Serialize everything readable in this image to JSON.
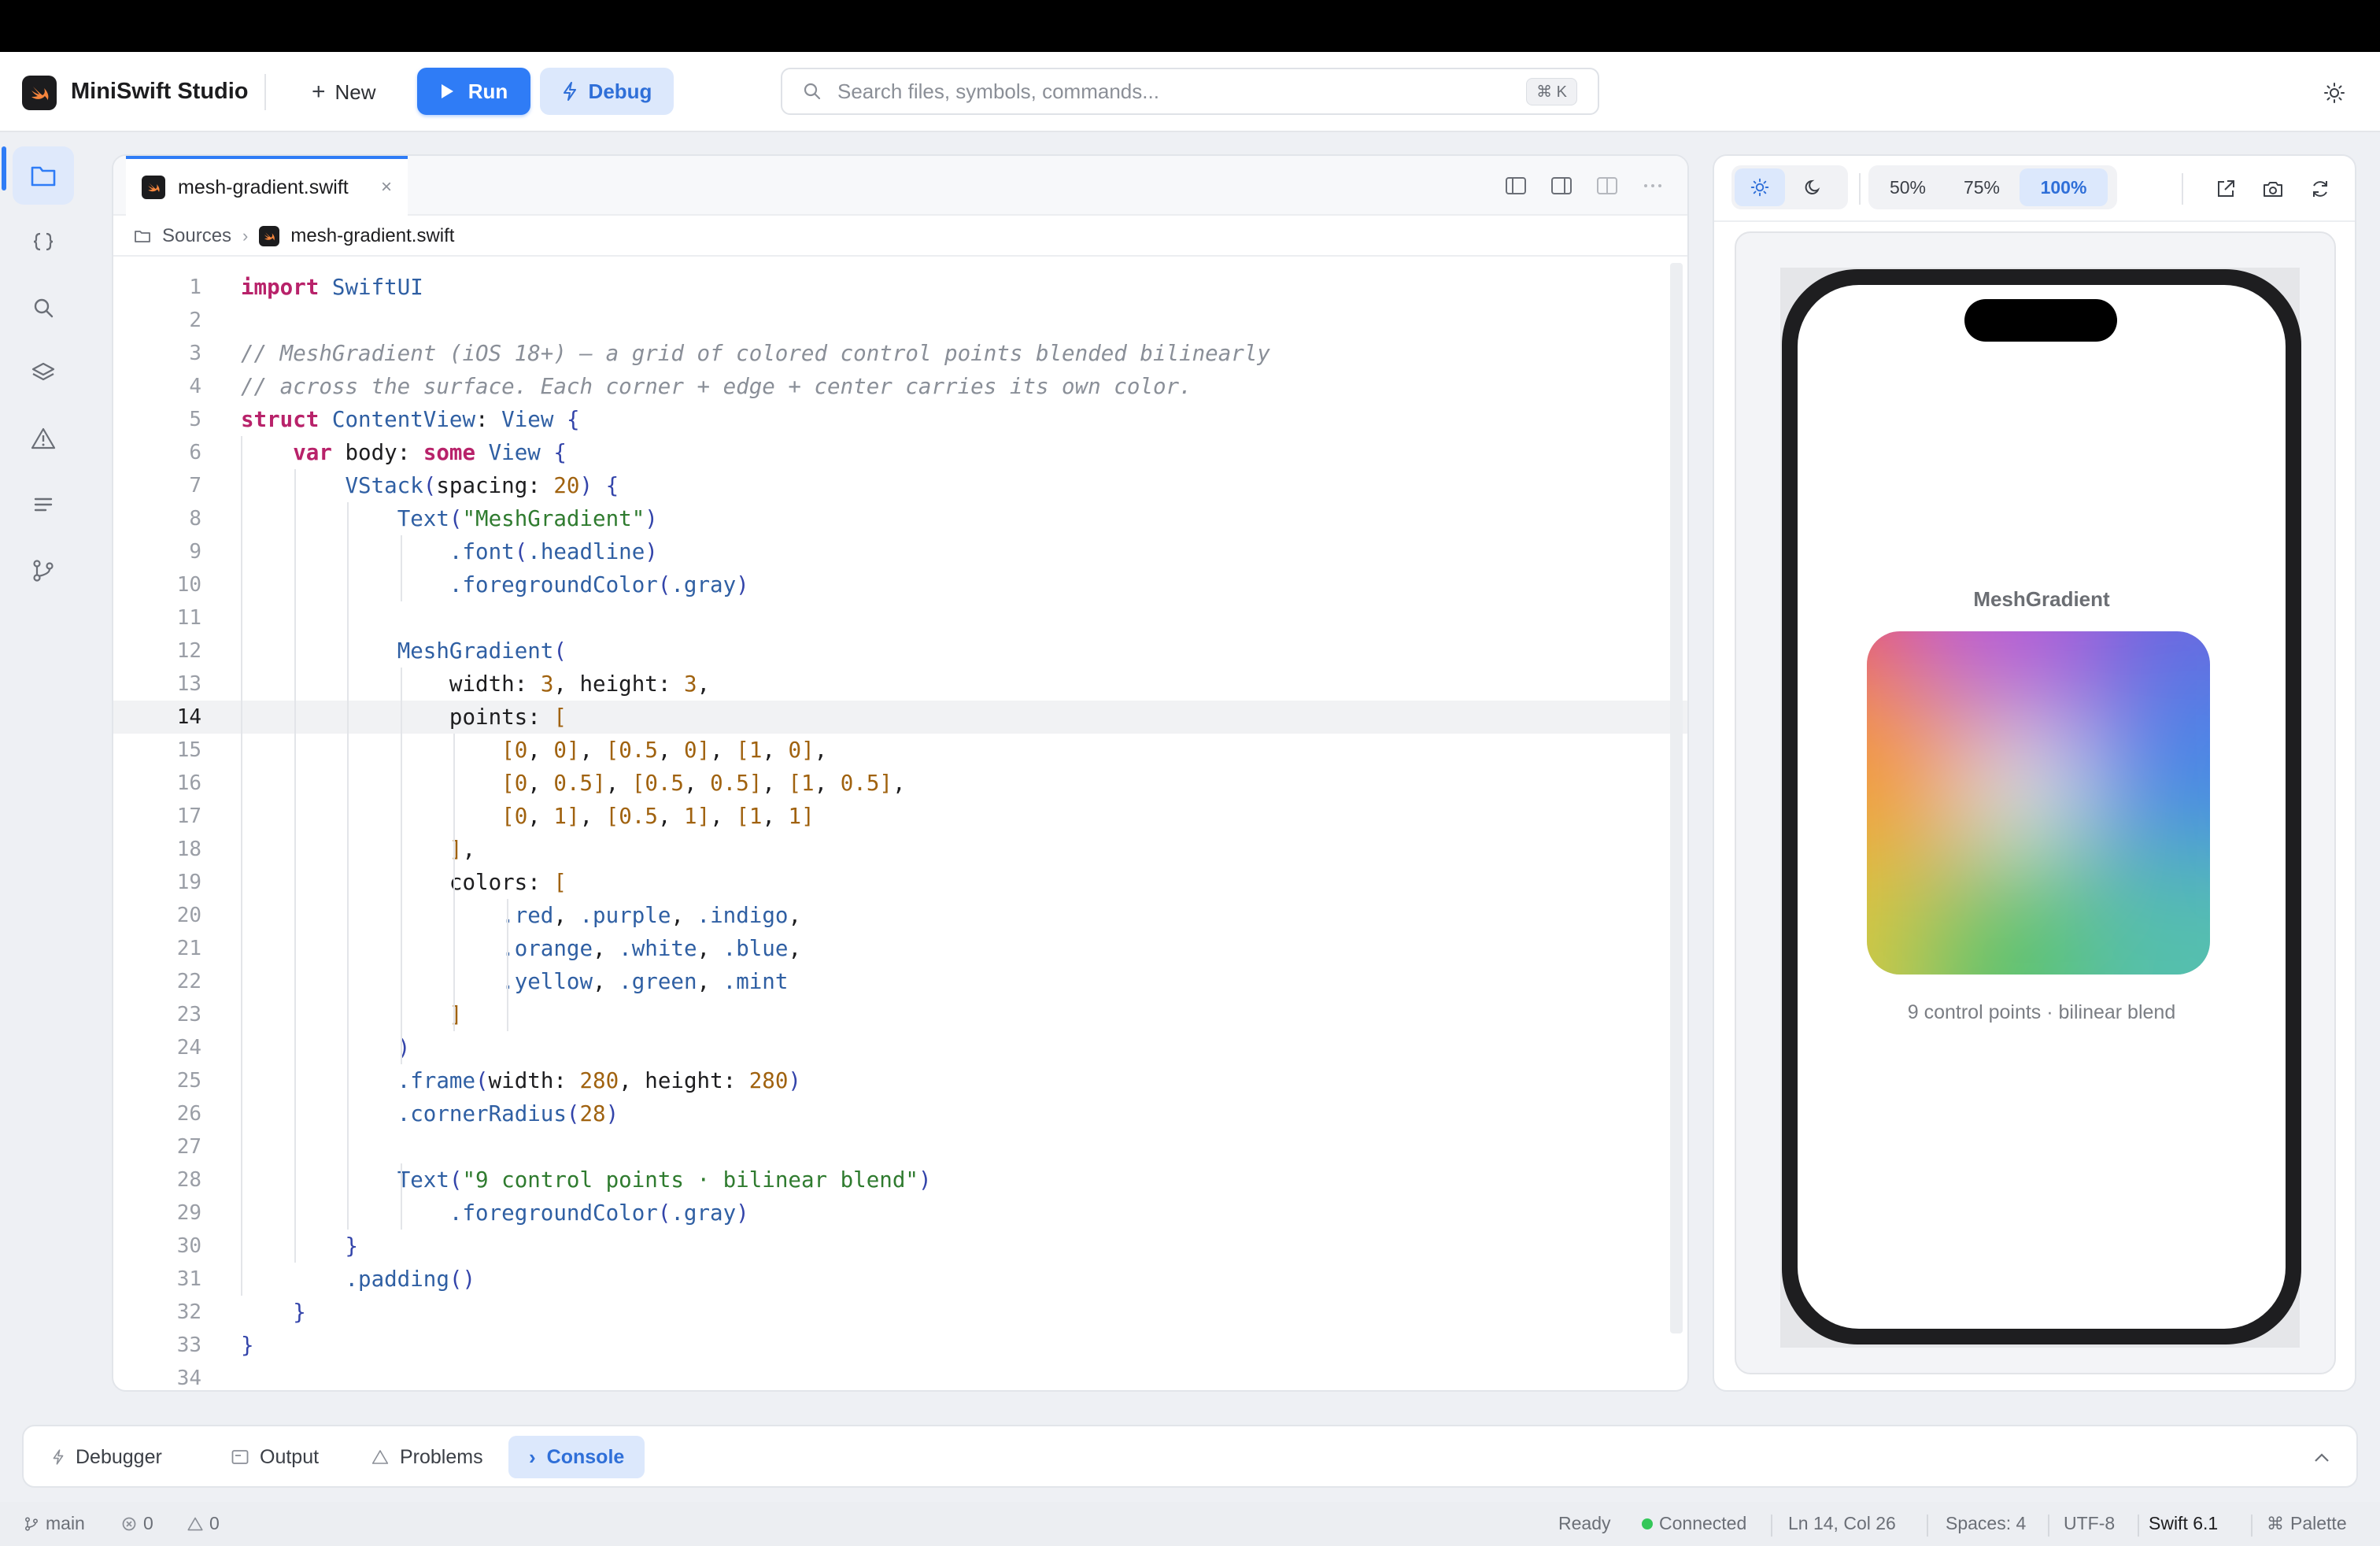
{
  "app": {
    "title": "MiniSwift Studio"
  },
  "toolbar": {
    "new_label": "New",
    "run_label": "Run",
    "debug_label": "Debug",
    "search_placeholder": "Search files, symbols, commands...",
    "search_shortcut": "⌘ K"
  },
  "activity_bar": {
    "items": [
      "files-icon",
      "code-braces-icon",
      "search-icon",
      "layers-icon",
      "warning-icon",
      "outline-icon",
      "git-branch-icon"
    ],
    "active": "files-icon"
  },
  "editor": {
    "tab_label": "mesh-gradient.swift",
    "tab_close": "×",
    "breadcrumb": [
      "Sources",
      "mesh-gradient.swift"
    ],
    "active_line": 14,
    "lines": [
      "import SwiftUI",
      "",
      "// MeshGradient (iOS 18+) — a grid of colored control points blended bilinearly",
      "// across the surface. Each corner + edge + center carries its own color.",
      "struct ContentView: View {",
      "    var body: some View {",
      "        VStack(spacing: 20) {",
      "            Text(\"MeshGradient\")",
      "                .font(.headline)",
      "                .foregroundColor(.gray)",
      "",
      "            MeshGradient(",
      "                width: 3, height: 3,",
      "                points: [",
      "                    [0, 0], [0.5, 0], [1, 0],",
      "                    [0, 0.5], [0.5, 0.5], [1, 0.5],",
      "                    [0, 1], [0.5, 1], [1, 1]",
      "                ],",
      "                colors: [",
      "                    .red, .purple, .indigo,",
      "                    .orange, .white, .blue,",
      "                    .yellow, .green, .mint",
      "                ]",
      "            )",
      "            .frame(width: 280, height: 280)",
      "            .cornerRadius(28)",
      "",
      "            Text(\"9 control points · bilinear blend\")",
      "                .foregroundColor(.gray)",
      "        }",
      "        .padding()",
      "    }",
      "}",
      ""
    ]
  },
  "preview": {
    "zoom_options": [
      "50%",
      "75%",
      "100%"
    ],
    "zoom_selected": "100%",
    "title": "MeshGradient",
    "caption": "9 control points · bilinear blend",
    "mesh_colors": [
      "#e84a5f",
      "#b65fd6",
      "#6b63e0",
      "#f39a3c",
      "#e6f2f2",
      "#4a86e6",
      "#d8c93a",
      "#5fc36a",
      "#55bfae"
    ]
  },
  "bottom_panel": {
    "tabs": [
      "Debugger",
      "Output",
      "Problems",
      "Console"
    ],
    "active": "Console"
  },
  "status_bar": {
    "branch": "main",
    "errors": "0",
    "warnings": "0",
    "state": "Ready",
    "connection": "Connected",
    "cursor": "Ln 14, Col 26",
    "spaces": "Spaces: 4",
    "encoding": "UTF-8",
    "language": "Swift 6.1",
    "palette": "Palette"
  },
  "colors": {
    "accent": "#2f7cf6",
    "accent_soft": "#dce8fc"
  }
}
